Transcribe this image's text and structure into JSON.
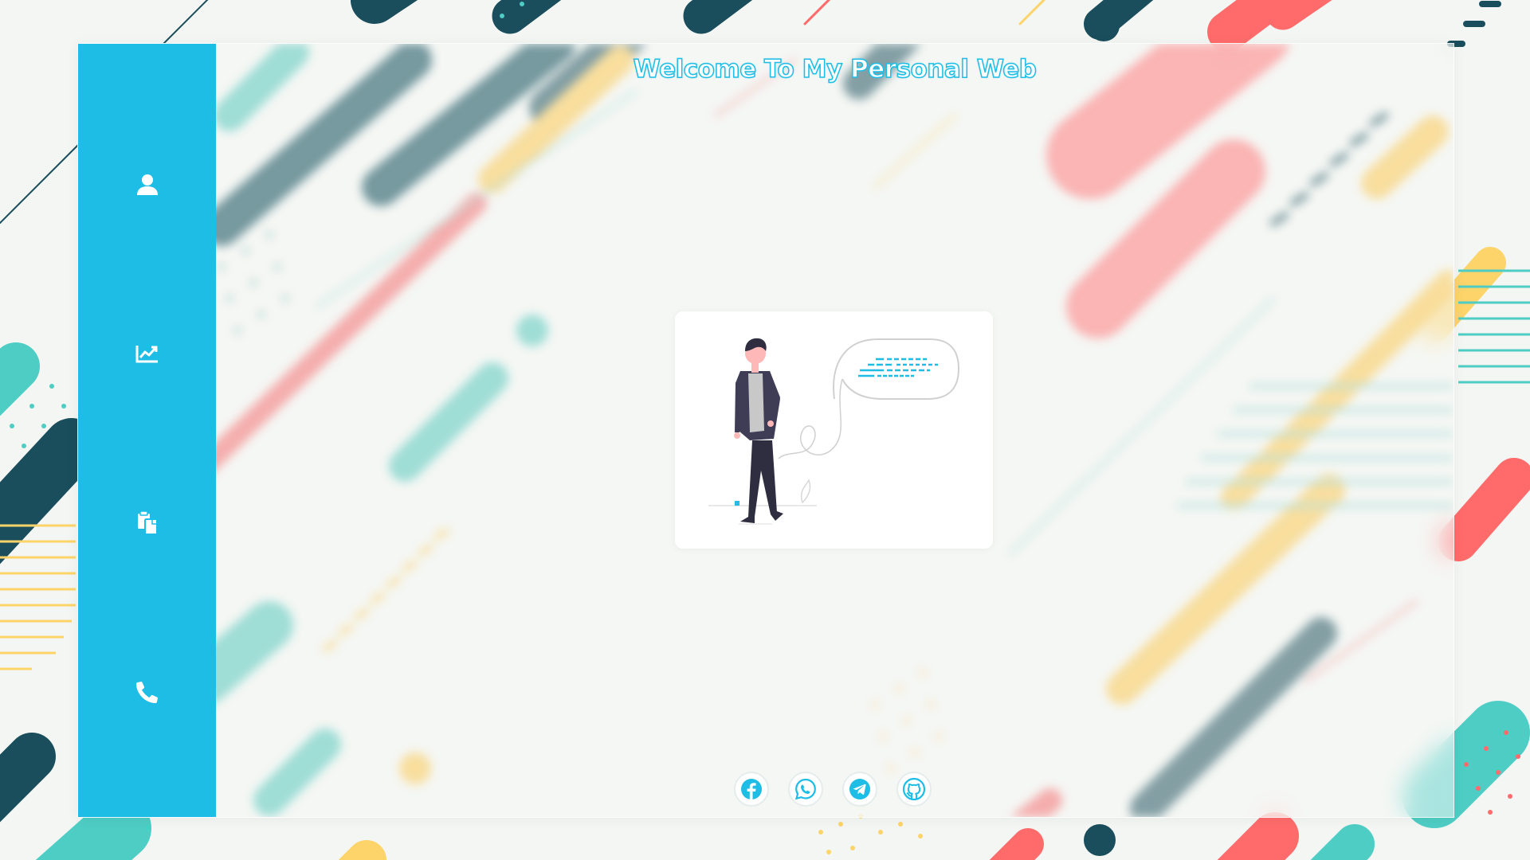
{
  "page": {
    "title": "Welcome To My Personal Web"
  },
  "colors": {
    "accent": "#1dbde6",
    "sidebar": "#1dbde6",
    "dark_teal": "#1b4e5c",
    "coral": "#ff6b6b",
    "mint": "#4ecdc4",
    "yellow": "#fcd46a"
  },
  "sidebar": {
    "items": [
      {
        "icon": "user-icon",
        "label": "Profile"
      },
      {
        "icon": "chart-line-icon",
        "label": "Skills"
      },
      {
        "icon": "copy-files-icon",
        "label": "Portfolio"
      },
      {
        "icon": "phone-icon",
        "label": "Contact"
      }
    ]
  },
  "hero": {
    "illustration": "person-walking-speech-bubble"
  },
  "socials": [
    {
      "icon": "facebook-icon",
      "name": "Facebook"
    },
    {
      "icon": "whatsapp-icon",
      "name": "WhatsApp"
    },
    {
      "icon": "telegram-icon",
      "name": "Telegram"
    },
    {
      "icon": "github-icon",
      "name": "GitHub"
    }
  ]
}
